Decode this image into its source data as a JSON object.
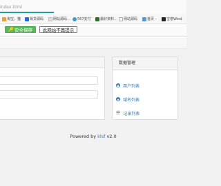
{
  "browser": {
    "url": "index.html",
    "load_progress_pct": 29
  },
  "bookmarks": [
    {
      "label": "淘宝，猫",
      "icon": "folder-icon",
      "color": "#f0a030"
    },
    {
      "label": "易贷源码",
      "icon": "site-icon",
      "color": "#2a6ad0"
    },
    {
      "label": "网站源码…",
      "icon": "site-icon",
      "color": "#e0e0e0"
    },
    {
      "label": "567支付",
      "icon": "pay-icon",
      "color": "#3a9ad9"
    },
    {
      "label": "最好资料…",
      "icon": "site-icon",
      "color": "#2c6f2c"
    },
    {
      "label": "网站源码",
      "icon": "page-icon",
      "color": "#dddddd"
    },
    {
      "label": "首页 -",
      "icon": "site-icon",
      "color": "#5a9bd5"
    },
    {
      "label": "宝塔Wind",
      "icon": "bt-icon",
      "color": "#222222"
    }
  ],
  "savebar": {
    "save_label": "安全保存",
    "never_label": "此网站不再提示"
  },
  "data_panel": {
    "title": "数据管理",
    "items": [
      {
        "label": "用户列表",
        "icon": "user-icon"
      },
      {
        "label": "域名列表",
        "icon": "globe-icon"
      },
      {
        "label": "记录列表",
        "icon": "list-icon"
      }
    ]
  },
  "footer": {
    "prefix": "Powered by ",
    "link": "klsf",
    "suffix": " v2.0"
  }
}
